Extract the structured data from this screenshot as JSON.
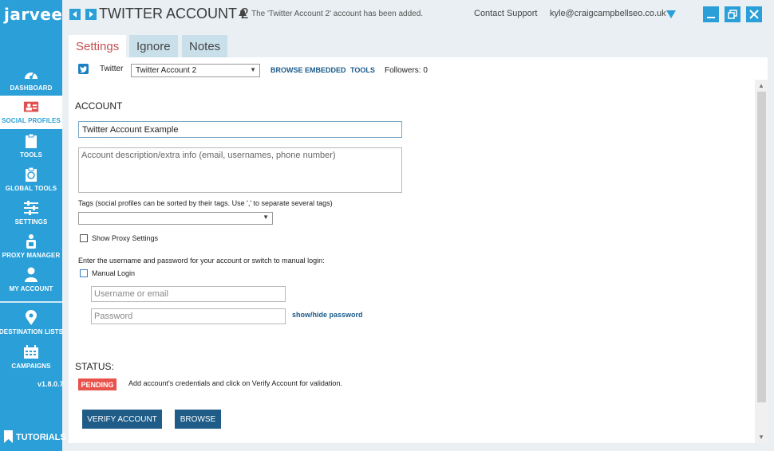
{
  "app": {
    "logo": "jarvee",
    "version": "v1.8.0.7",
    "tutorials": "TUTORIALS"
  },
  "sidebar": {
    "items": [
      {
        "label": "DASHBOARD",
        "icon": "dashboard-icon"
      },
      {
        "label": "SOCIAL PROFILES",
        "icon": "social-profiles-icon"
      },
      {
        "label": "TOOLS",
        "icon": "tools-icon"
      },
      {
        "label": "GLOBAL TOOLS",
        "icon": "global-tools-icon"
      },
      {
        "label": "SETTINGS",
        "icon": "settings-icon"
      },
      {
        "label": "PROXY MANAGER",
        "icon": "proxy-manager-icon"
      },
      {
        "label": "MY ACCOUNT",
        "icon": "my-account-icon"
      },
      {
        "label": "DESTINATION LISTS",
        "icon": "destination-lists-icon"
      },
      {
        "label": "CAMPAIGNS",
        "icon": "campaigns-icon"
      }
    ]
  },
  "header": {
    "title": "TWITTER ACCOUNT 2",
    "notice": "The 'Twitter Account 2' account has been added.",
    "contact_support": "Contact Support",
    "user_email": "kyle@craigcampbellseo.co.uk"
  },
  "tabs": [
    "Settings",
    "Ignore",
    "Notes"
  ],
  "account_bar": {
    "network": "Twitter",
    "selected_account": "Twitter Account 2",
    "browse_embedded": "BROWSE EMBEDDED",
    "tools": "TOOLS",
    "followers": "Followers: 0"
  },
  "form": {
    "account_heading": "ACCOUNT",
    "account_name": "Twitter Account Example",
    "description_placeholder": "Account description/extra info (email, usernames, phone number)",
    "tags_label": "Tags (social profiles can be sorted by their tags. Use ',' to separate several tags)",
    "show_proxy": "Show Proxy Settings",
    "login_label": "Enter the username and password for your account or switch to manual login:",
    "manual_login": "Manual Login",
    "username_placeholder": "Username or email",
    "password_placeholder": "Password",
    "show_hide_password": "show/hide password"
  },
  "status": {
    "heading": "STATUS:",
    "badge": "PENDING",
    "message": "Add account's credentials and click on Verify Account for validation."
  },
  "buttons": {
    "verify": "VERIFY ACCOUNT",
    "browse": "BROWSE"
  },
  "colors": {
    "brand": "#2a9fd8",
    "pending": "#e8524a",
    "button": "#1f5d88",
    "active_tab_text": "#c35052"
  }
}
